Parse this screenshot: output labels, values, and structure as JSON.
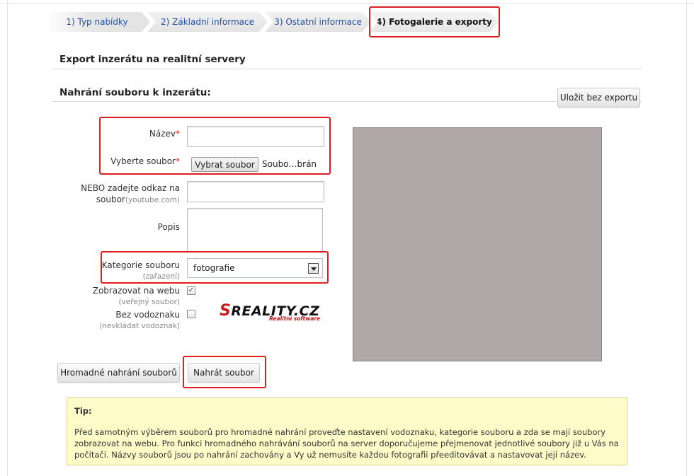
{
  "wizard": {
    "steps": [
      {
        "label": "1) Typ nabídky"
      },
      {
        "label": "2) Základní informace"
      },
      {
        "label": "3) Ostatní informace"
      },
      {
        "label": "4) Fotogalerie a exporty"
      }
    ],
    "active_index": 3
  },
  "export_section": {
    "title": "Export inzerátu na realitní servery"
  },
  "upload_section": {
    "title": "Nahrání souboru k inzerátu:",
    "save_without_export_label": "Uložit bez exportu"
  },
  "form": {
    "name": {
      "label": "Název",
      "required_mark": "*",
      "value": ""
    },
    "file": {
      "label": "Vyberte soubor",
      "required_mark": "*",
      "button_label": "Vybrat soubor",
      "status_text": "Soubo…brán"
    },
    "link": {
      "label_line1": "NEBO zadejte odkaz na",
      "label_line2": "soubor",
      "label_hint": "(youtube.com)",
      "value": ""
    },
    "description": {
      "label": "Popis",
      "value": ""
    },
    "category": {
      "label": "Kategorie souboru",
      "hint": "(zařazení)",
      "selected": "fotografie"
    },
    "show_on_web": {
      "label": "Zobrazovat na webu",
      "hint": "(veřejný soubor)",
      "checked": true,
      "check_glyph": "✓"
    },
    "no_watermark": {
      "label": "Bez vodoznaku",
      "hint": "(nevkládat vodoznak)",
      "checked": false
    }
  },
  "logo": {
    "wordmark": "REALITY.CZ",
    "wordmark_prefix": "S",
    "tagline": "Realitní software"
  },
  "buttons": {
    "bulk_upload_label": "Hromadné nahrání souborů",
    "upload_label": "Nahrát soubor"
  },
  "tip": {
    "title": "Tip:",
    "text": "Před samotným výběrem souborů pro hromadné nahrání proveďte nastavení vodoznaku, kategorie souboru a zda se mají soubory zobrazovat na webu. Pro funkci hromadného nahrávání souborů na server doporučujeme přejmenovat jednotlivé soubory již u Vás na počítači. Názvy souborů jsou po nahrání zachovány a Vy už nemusíte každou fotografii přeeditovávat a nastavovat její název."
  },
  "colors": {
    "highlight": "#e21d1d",
    "link": "#1f4fa8",
    "tip_background": "#fdfbc8",
    "preview_placeholder": "#b1a9a9"
  }
}
